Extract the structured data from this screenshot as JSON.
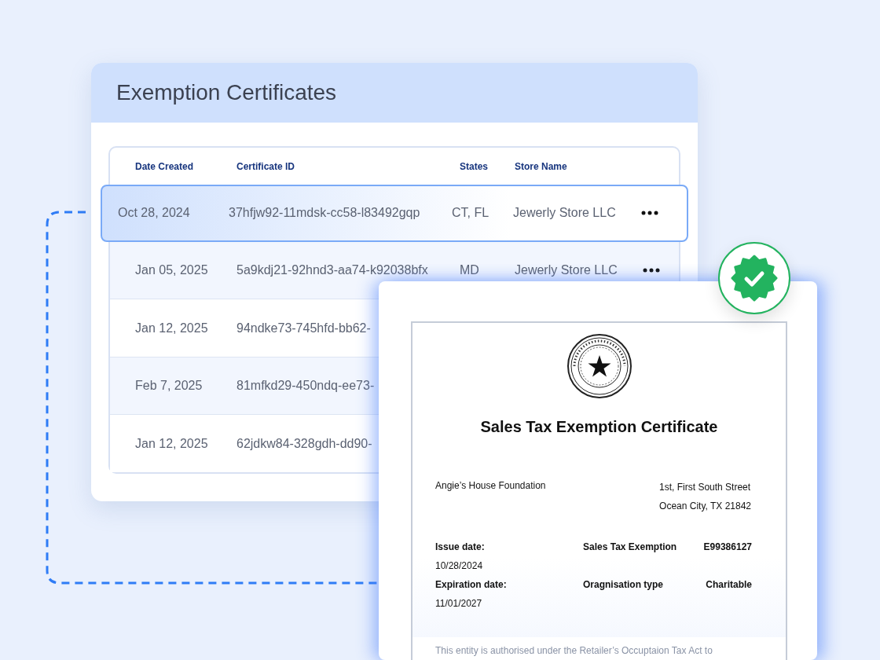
{
  "panel": {
    "title": "Exemption Certificates"
  },
  "table": {
    "columns": [
      "Date Created",
      "Certificate ID",
      "States",
      "Store Name"
    ],
    "rows": [
      {
        "date": "Oct 28, 2024",
        "certificate_id": "37hfjw92-11mdsk-cc58-l83492gqp",
        "states": "CT, FL",
        "store": "Jewerly Store LLC",
        "selected": true
      },
      {
        "date": "Jan 05, 2025",
        "certificate_id": "5a9kdj21-92hnd3-aa74-k92038bfx",
        "states": "MD",
        "store": "Jewerly Store LLC",
        "selected": false
      },
      {
        "date": "Jan 12, 2025",
        "certificate_id": "94ndke73-745hfd-bb62-",
        "selected": false
      },
      {
        "date": "Feb 7, 2025",
        "certificate_id": "81mfkd29-450ndq-ee73-",
        "selected": false
      },
      {
        "date": "Jan 12, 2025",
        "certificate_id": "62jdkw84-328gdh-dd90-",
        "selected": false
      }
    ]
  },
  "certificate": {
    "verified": true,
    "title": "Sales Tax Exemption Certificate",
    "organisation": "Angie’s House Foundation",
    "address": [
      "1st, First South Street",
      "Ocean City, TX 21842"
    ],
    "fields": [
      {
        "label": "Issue date:",
        "value": "10/28/2024",
        "right_label": "Sales Tax Exemption",
        "right_value": "E99386127"
      },
      {
        "label": "Expiration date:",
        "value": "11/01/2027",
        "right_label": "Oragnisation type",
        "right_value": "Charitable"
      }
    ],
    "footer": "This entity is authorised under the Retailer’s Occuptaion Tax Act to"
  }
}
